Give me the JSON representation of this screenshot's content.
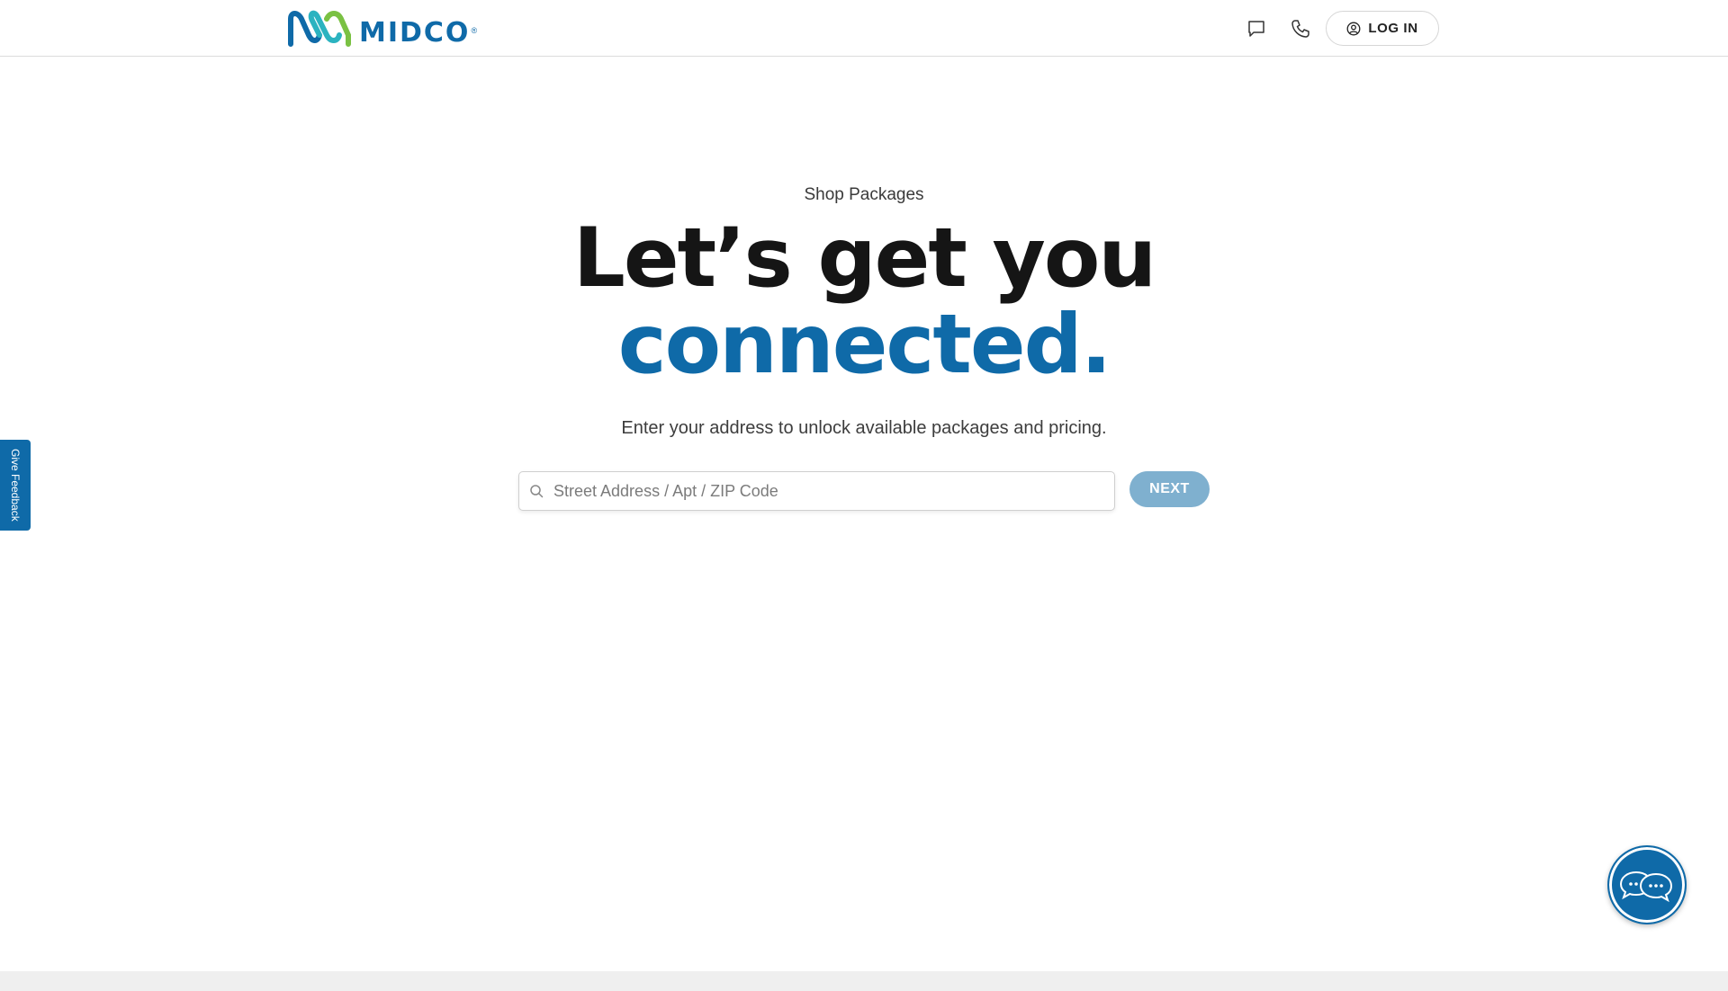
{
  "header": {
    "logo_text": "MIDCO",
    "logo_reg": "®",
    "chat_icon": "chat-bubble-icon",
    "phone_icon": "phone-icon",
    "login_label": "LOG IN",
    "login_icon": "user-circle-icon"
  },
  "hero": {
    "eyebrow": "Shop Packages",
    "headline_line1": "Let’s get you",
    "headline_line2": "connected.",
    "subtext": "Enter your address to unlock available packages and pricing."
  },
  "search": {
    "placeholder": "Street Address / Apt / ZIP Code",
    "value": "",
    "icon": "search-icon",
    "next_label": "NEXT"
  },
  "feedback": {
    "label": "Give Feedback"
  },
  "chat_widget": {
    "icon": "chat-bubbles-icon"
  },
  "colors": {
    "brand_blue": "#0f6aa8",
    "brand_green": "#7ac143",
    "next_button": "#7fb0cf",
    "headline_dark": "#151515"
  }
}
